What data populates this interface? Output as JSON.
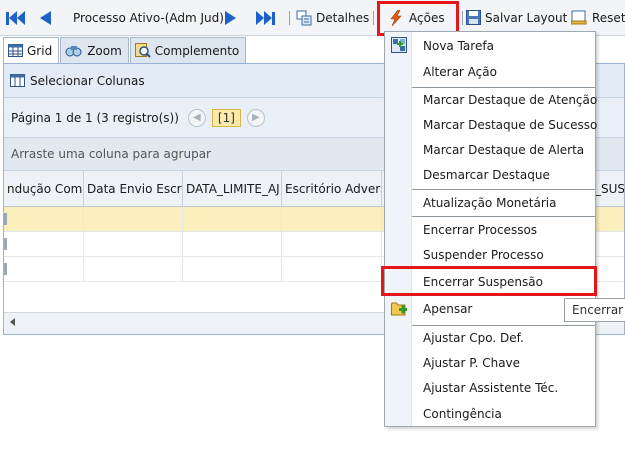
{
  "toolbar": {
    "title": "Processo Ativo-(Adm Jud)",
    "details_label": "Detalhes",
    "acoes_label": "Ações",
    "save_layout_label": "Salvar Layout",
    "reset_label": "Reset"
  },
  "tabs": [
    {
      "label": "Grid",
      "icon": "grid-icon"
    },
    {
      "label": "Zoom",
      "icon": "zoom-icon"
    },
    {
      "label": "Complemento",
      "icon": "complement-icon"
    }
  ],
  "grid": {
    "select_columns_label": "Selecionar Colunas",
    "pager_text": "Página 1 de 1 (3 registro(s))",
    "current_page": "[1]",
    "group_hint": "Arraste uma coluna para agrupar",
    "columns": [
      "ndução Compa",
      "Data Envio Escrito",
      "DATA_LIMITE_AJ",
      "Escritório Adverso",
      "_SUSP"
    ]
  },
  "menu": {
    "items": [
      "Nova Tarefa",
      "Alterar Ação",
      "Marcar Destaque de Atenção",
      "Marcar Destaque de Sucesso",
      "Marcar Destaque de Alerta",
      "Desmarcar Destaque",
      "Atualização Monetária",
      "Encerrar Processos",
      "Suspender Processo",
      "Encerrar Suspensão",
      "Apensar",
      "Ajustar Cpo. Def.",
      "Ajustar P. Chave",
      "Ajustar Assistente Téc.",
      "Contingência"
    ]
  },
  "tooltip": "Encerrar Suspensão",
  "colors": {
    "highlight_red": "#e4161b",
    "nav_blue": "#1e62c8",
    "selected_row": "#fcefbe"
  }
}
